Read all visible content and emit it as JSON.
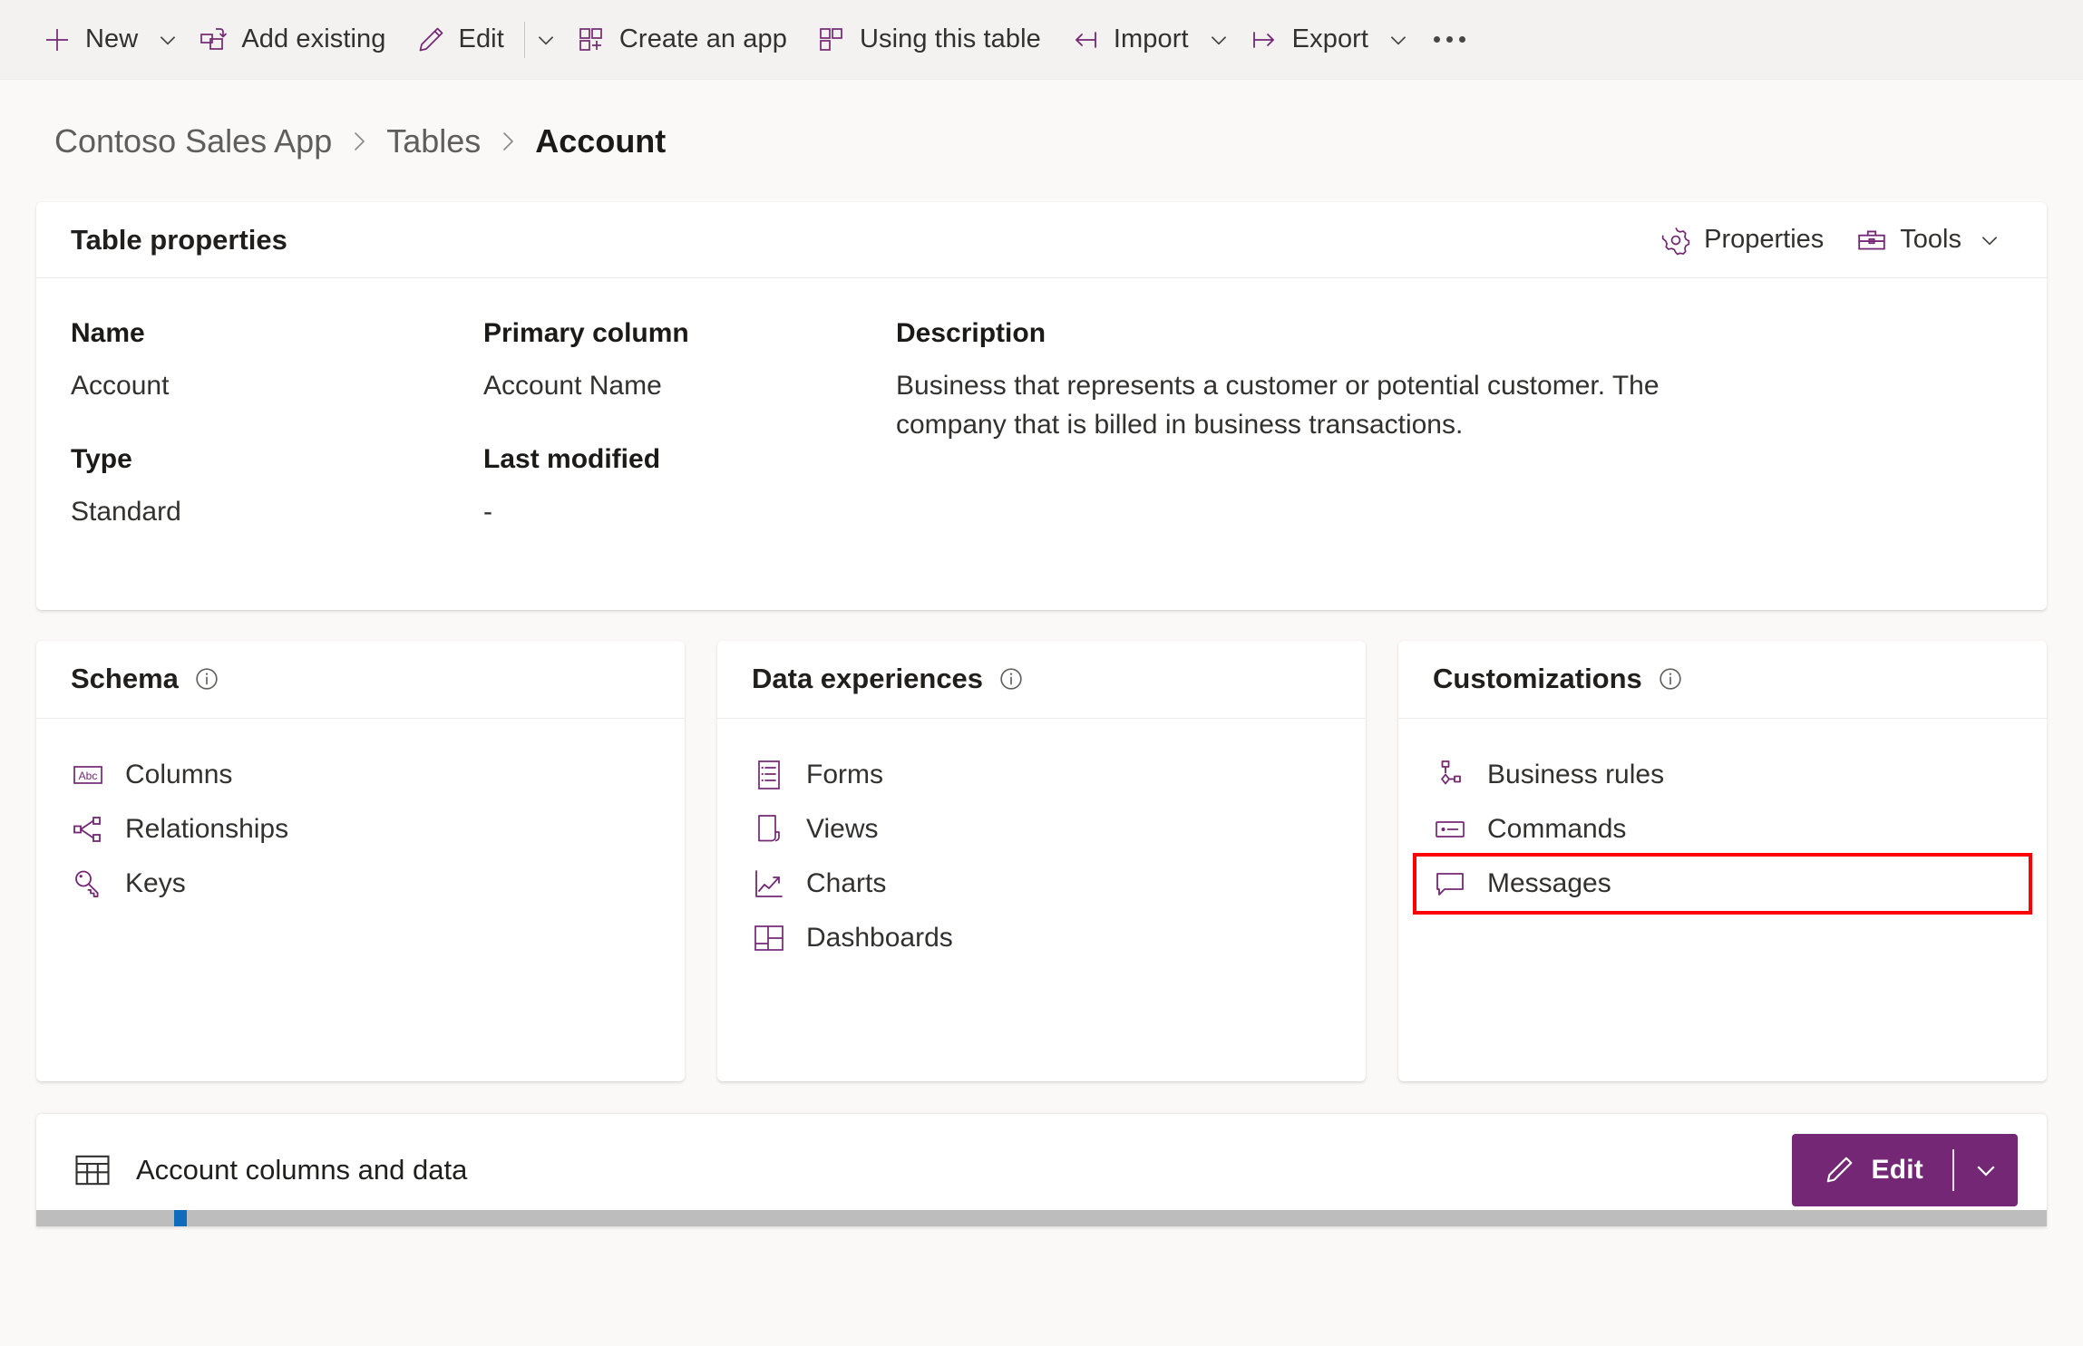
{
  "commandbar": {
    "items": [
      {
        "label": "New",
        "icon": "plus-icon",
        "caret": true
      },
      {
        "label": "Add existing",
        "icon": "add-existing-icon",
        "caret": false
      },
      {
        "label": "Edit",
        "icon": "pencil-icon",
        "caret": true,
        "separator": true
      },
      {
        "label": "Create an app",
        "icon": "create-app-icon",
        "caret": false
      },
      {
        "label": "Using this table",
        "icon": "table-grid-icon",
        "caret": false
      },
      {
        "label": "Import",
        "icon": "import-arrow-icon",
        "caret": true
      },
      {
        "label": "Export",
        "icon": "export-arrow-icon",
        "caret": true
      }
    ],
    "overflow_label": "More commands"
  },
  "breadcrumb": {
    "items": [
      {
        "label": "Contoso Sales App",
        "current": false
      },
      {
        "label": "Tables",
        "current": false
      },
      {
        "label": "Account",
        "current": true
      }
    ],
    "separator": "›"
  },
  "table_properties": {
    "title": "Table properties",
    "actions": [
      {
        "label": "Properties",
        "icon": "gear-icon",
        "caret": false
      },
      {
        "label": "Tools",
        "icon": "toolbox-icon",
        "caret": true
      }
    ],
    "fields": [
      {
        "label": "Name",
        "value": "Account"
      },
      {
        "label": "Primary column",
        "value": "Account Name"
      },
      {
        "label": "Description",
        "value": "Business that represents a customer or potential customer. The company that is billed in business transactions."
      },
      {
        "label": "Type",
        "value": "Standard"
      },
      {
        "label": "Last modified",
        "value": "-"
      }
    ]
  },
  "sections": [
    {
      "title": "Schema",
      "info_icon": "info-icon",
      "links": [
        {
          "label": "Columns",
          "icon": "abc-box-icon",
          "highlighted": false
        },
        {
          "label": "Relationships",
          "icon": "relationships-icon",
          "highlighted": false
        },
        {
          "label": "Keys",
          "icon": "key-icon",
          "highlighted": false
        }
      ]
    },
    {
      "title": "Data experiences",
      "info_icon": "info-icon",
      "links": [
        {
          "label": "Forms",
          "icon": "form-list-icon",
          "highlighted": false
        },
        {
          "label": "Views",
          "icon": "view-page-icon",
          "highlighted": false
        },
        {
          "label": "Charts",
          "icon": "line-chart-icon",
          "highlighted": false
        },
        {
          "label": "Dashboards",
          "icon": "dashboard-tiles-icon",
          "highlighted": false
        }
      ]
    },
    {
      "title": "Customizations",
      "info_icon": "info-icon",
      "links": [
        {
          "label": "Business rules",
          "icon": "business-rules-icon",
          "highlighted": false
        },
        {
          "label": "Commands",
          "icon": "commands-icon",
          "highlighted": false
        },
        {
          "label": "Messages",
          "icon": "message-bubble-icon",
          "highlighted": true
        }
      ]
    }
  ],
  "bottom_bar": {
    "title": "Account columns and data",
    "icon": "table-icon",
    "edit_button": {
      "label": "Edit",
      "icon": "pencil-icon",
      "caret": true
    }
  },
  "colors": {
    "accent_purple": "#742774",
    "highlight_red": "#ff0000",
    "page_background": "#faf9f8",
    "commandbar_background": "#f3f2f1",
    "card_background": "#ffffff",
    "text_primary": "#323130",
    "text_secondary": "#605e5c"
  }
}
